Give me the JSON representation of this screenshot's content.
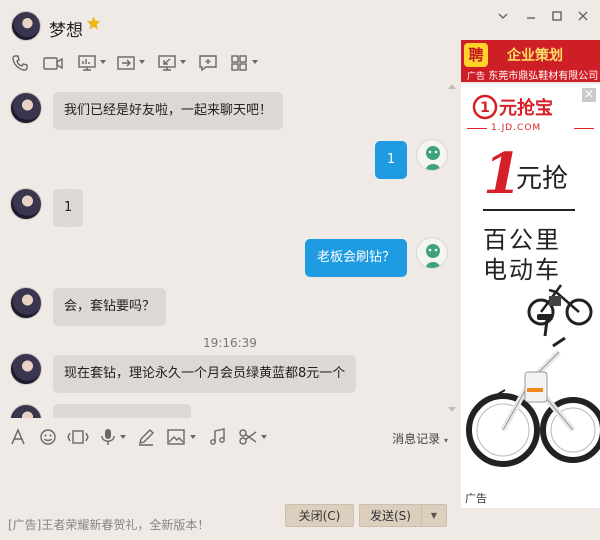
{
  "contact": {
    "name": "梦想"
  },
  "messages": {
    "m1": "我们已经是好友啦，一起来聊天吧！",
    "m2": "1",
    "m3": "1",
    "m4": "老板会刷钻？",
    "m5": "会，套钻要吗？",
    "time": "19:16:39",
    "m6": "现在套钻，理论永久一个月会员绿黄蓝都8元一个"
  },
  "input_toolbar": {
    "history": "消息记录"
  },
  "footer": {
    "ad": "[广告]王者荣耀新春贺礼，全新版本！",
    "close_label": "关闭(C)",
    "send_label": "发送(S)"
  },
  "ad_top": {
    "hire_badge": "聘",
    "title": "企业策划",
    "corner": "广告",
    "company": "东莞市鼎弘鞋材有限公司"
  },
  "ad_main": {
    "logo": "1元抢宝",
    "logo_sub": "1.JD.COM",
    "price": "1",
    "grab": "元抢",
    "line3": "百公里",
    "line4": "电动车",
    "label": "广告"
  },
  "colors": {
    "background": "#efeae6",
    "incoming_bubble": "#dcd8d4",
    "outgoing_bubble": "#1f9be2",
    "ad_red": "#cf1f26",
    "button": "#dccfbd"
  }
}
